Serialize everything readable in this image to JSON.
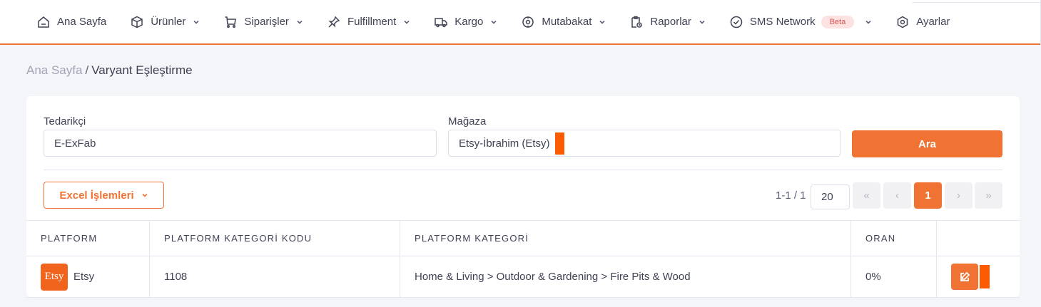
{
  "nav": {
    "items": [
      {
        "label": "Ana Sayfa",
        "icon": "home-icon",
        "dropdown": false
      },
      {
        "label": "Ürünler",
        "icon": "box-icon",
        "dropdown": true
      },
      {
        "label": "Siparişler",
        "icon": "cart-icon",
        "dropdown": true
      },
      {
        "label": "Fulfillment",
        "icon": "pin-icon",
        "dropdown": true
      },
      {
        "label": "Kargo",
        "icon": "truck-icon",
        "dropdown": true
      },
      {
        "label": "Mutabakat",
        "icon": "reconcile-icon",
        "dropdown": true
      },
      {
        "label": "Raporlar",
        "icon": "report-icon",
        "dropdown": true
      },
      {
        "label": "SMS Network",
        "icon": "check-circle-icon",
        "dropdown": true,
        "badge": "Beta"
      },
      {
        "label": "Ayarlar",
        "icon": "settings-icon",
        "dropdown": false
      }
    ]
  },
  "breadcrumb": {
    "home": "Ana Sayfa",
    "separator": "/",
    "current": "Varyant Eşleştirme"
  },
  "filters": {
    "supplier_label": "Tedarikçi",
    "supplier_value": "E-ExFab",
    "store_label": "Mağaza",
    "store_value": "Etsy-İbrahim (Etsy)",
    "search_button": "Ara"
  },
  "excel_button": "Excel İşlemleri",
  "pagination": {
    "count_text": "1-1 / 1",
    "page_size": "20",
    "first": "«",
    "prev": "‹",
    "current": "1",
    "next": "›",
    "last": "»"
  },
  "table": {
    "headers": [
      "PLATFORM",
      "PLATFORM KATEGORİ KODU",
      "PLATFORM KATEGORİ",
      "ORAN",
      ""
    ],
    "rows": [
      {
        "platform_logo": "Etsy",
        "platform": "Etsy",
        "code": "1108",
        "category": "Home & Living > Outdoor & Gardening > Fire Pits & Wood",
        "ratio": "0%"
      }
    ]
  },
  "colors": {
    "accent": "#f07334",
    "marker": "#fe5a00",
    "etsy": "#f1641e"
  }
}
